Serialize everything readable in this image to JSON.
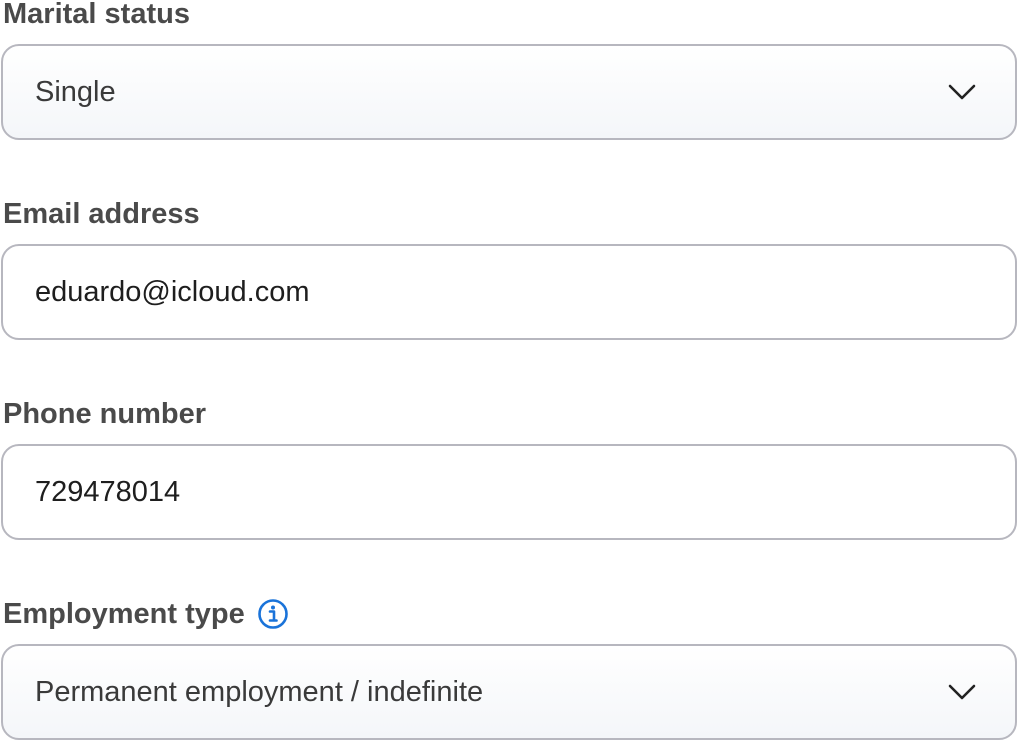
{
  "form": {
    "marital_status": {
      "label": "Marital status",
      "value": "Single",
      "icon": "chevron-down-icon"
    },
    "email": {
      "label": "Email address",
      "value": "eduardo@icloud.com"
    },
    "phone": {
      "label": "Phone number",
      "value": "729478014"
    },
    "employment_type": {
      "label": "Employment type",
      "value": "Permanent employment / indefinite",
      "info_icon": "info-icon",
      "icon": "chevron-down-icon"
    }
  },
  "colors": {
    "label_text": "#4a4a4a",
    "border": "#b7b7bf",
    "info_icon": "#1a73d9"
  }
}
